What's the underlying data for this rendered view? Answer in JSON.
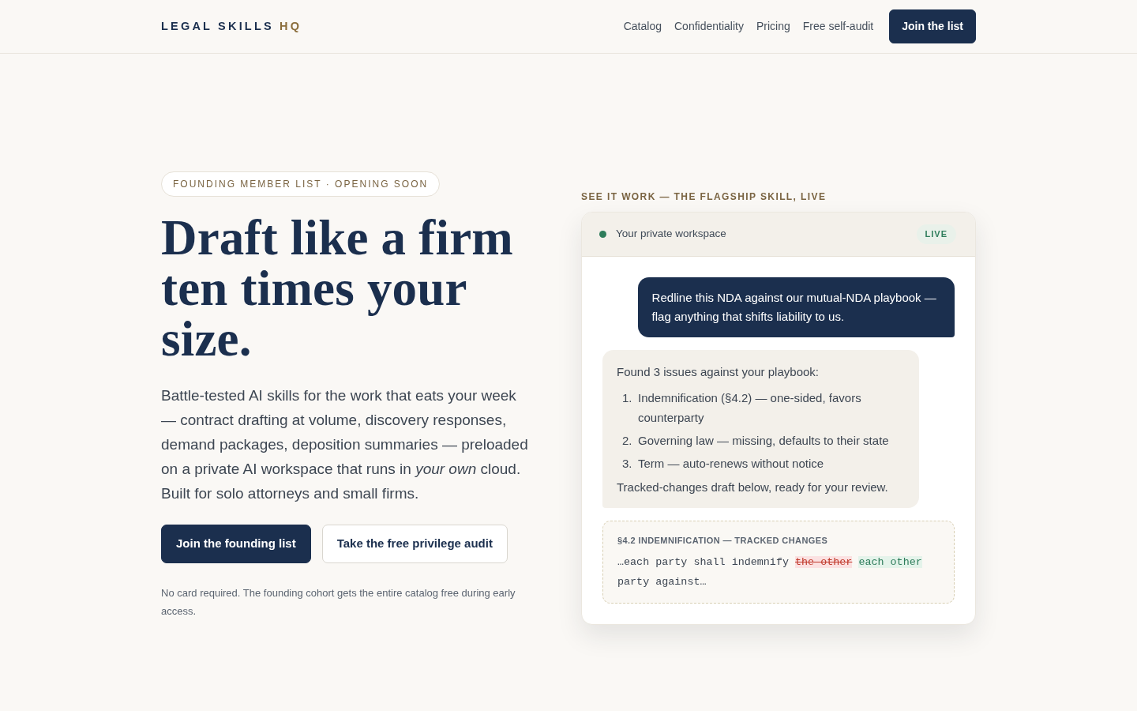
{
  "brand": {
    "name": "LEGAL SKILLS",
    "accent": "HQ"
  },
  "nav": {
    "links": [
      "Catalog",
      "Confidentiality",
      "Pricing",
      "Free self-audit"
    ],
    "cta": "Join the list"
  },
  "hero": {
    "eyebrow": "FOUNDING MEMBER LIST · OPENING SOON",
    "headline": "Draft like a firm ten times your size.",
    "lede": "Battle-tested AI skills for the work that eats your week — contract drafting at volume, discovery responses, demand packages, deposition summaries — preloaded on a private AI workspace that runs in *your own* cloud. Built for solo attorneys and small firms.",
    "buttons": [
      {
        "label": "Join the founding list",
        "kind": "primary"
      },
      {
        "label": "Take the free privilege audit",
        "kind": "outline"
      }
    ],
    "note": "No card required. The founding cohort gets the entire catalog free during early access."
  },
  "demo": {
    "label": "SEE IT WORK — THE FLAGSHIP SKILL, LIVE",
    "header": {
      "title": "Your private workspace",
      "badge": "LIVE"
    },
    "messages": [
      {
        "kind": "user",
        "text": "Redline this NDA against our mutual-NDA playbook — flag anything that shifts liability to us."
      },
      {
        "kind": "assistant",
        "intro": "Found 3 issues against your playbook:",
        "items": [
          {
            "number": "1.",
            "text": "Indemnification (§4.2) — one-sided, favors counterparty"
          },
          {
            "number": "2.",
            "text": "Governing law — missing, defaults to their state"
          },
          {
            "number": "3.",
            "text": "Term — auto-renews without notice"
          }
        ],
        "outro": "Tracked-changes draft below, ready for your review."
      }
    ],
    "redline": {
      "title": "§4.2 INDEMNIFICATION — TRACKED CHANGES",
      "segments": [
        {
          "kind": "plain",
          "text": "…each party shall indemnify"
        },
        {
          "kind": "deleted",
          "text": "the other"
        },
        {
          "kind": "inserted",
          "text": "each other"
        },
        {
          "kind": "plain",
          "text": "party against…"
        }
      ]
    }
  }
}
